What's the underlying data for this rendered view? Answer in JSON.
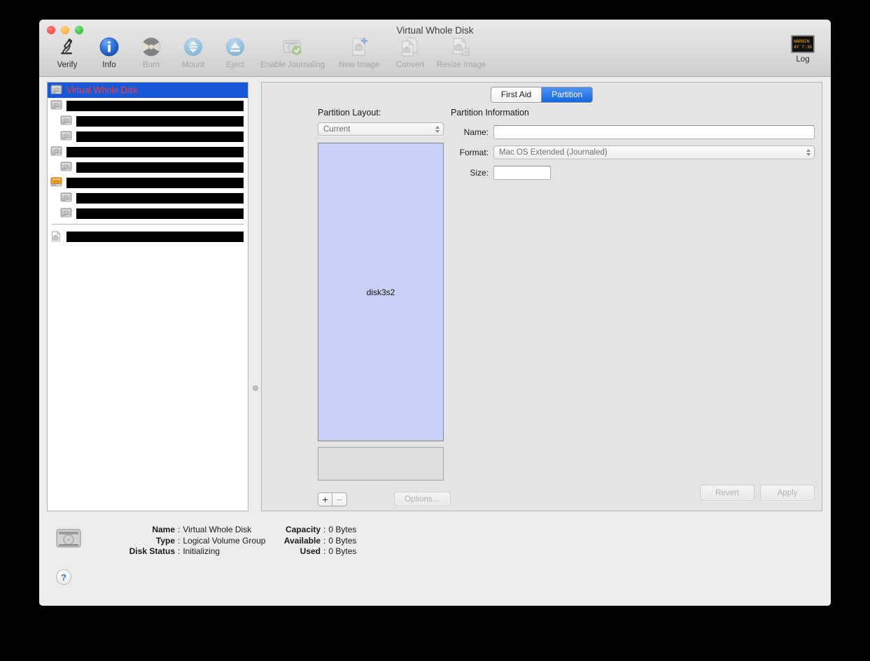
{
  "window": {
    "title": "Virtual Whole Disk"
  },
  "toolbar": {
    "items": [
      {
        "label": "Verify",
        "icon": "microscope-icon",
        "enabled": true
      },
      {
        "label": "Info",
        "icon": "info-circle-icon",
        "enabled": true
      },
      {
        "label": "Burn",
        "icon": "burn-radioactive-icon",
        "enabled": false
      },
      {
        "label": "Mount",
        "icon": "mount-arrows-icon",
        "enabled": false
      },
      {
        "label": "Eject",
        "icon": "eject-icon",
        "enabled": false
      },
      {
        "label": "Enable Journaling",
        "icon": "journaling-disk-check-icon",
        "enabled": false
      },
      {
        "label": "New Image",
        "icon": "new-image-icon",
        "enabled": false
      },
      {
        "label": "Convert",
        "icon": "convert-image-icon",
        "enabled": false
      },
      {
        "label": "Resize Image",
        "icon": "resize-image-icon",
        "enabled": false
      }
    ],
    "log": {
      "label": "Log",
      "screen_lines": [
        "WARNIN",
        "AY 7:36"
      ],
      "text_color": "#e8a317"
    }
  },
  "sidebar": {
    "rows": [
      {
        "icon": "hard-disk-icon",
        "label": "Virtual Whole Disk",
        "selected": true,
        "redacted": false,
        "indent": false
      },
      {
        "icon": "hard-disk-icon",
        "label": "",
        "selected": false,
        "redacted": true,
        "indent": false
      },
      {
        "icon": "volume-icon",
        "label": "",
        "selected": false,
        "redacted": true,
        "indent": true
      },
      {
        "icon": "volume-icon",
        "label": "",
        "selected": false,
        "redacted": true,
        "indent": true
      },
      {
        "icon": "hard-disk-icon",
        "label": "",
        "selected": false,
        "redacted": true,
        "indent": false
      },
      {
        "icon": "volume-icon",
        "label": "",
        "selected": false,
        "redacted": true,
        "indent": true
      },
      {
        "icon": "hard-disk-orange-icon",
        "label": "",
        "selected": false,
        "redacted": true,
        "indent": false
      },
      {
        "icon": "volume-icon",
        "label": "",
        "selected": false,
        "redacted": true,
        "indent": true
      },
      {
        "icon": "volume-icon",
        "label": "",
        "selected": false,
        "redacted": true,
        "indent": true
      }
    ],
    "after_divider": [
      {
        "icon": "disk-image-icon",
        "label": "",
        "selected": false,
        "redacted": true,
        "indent": false
      }
    ]
  },
  "tabs": [
    {
      "label": "First Aid",
      "active": false
    },
    {
      "label": "Partition",
      "active": true
    }
  ],
  "partition_layout": {
    "section_label": "Partition Layout:",
    "scheme_value": "Current",
    "partitions": [
      {
        "name": "disk3s2"
      }
    ],
    "add_button": "+",
    "remove_button": "−",
    "options_button": "Options…",
    "options_enabled": false
  },
  "partition_information": {
    "section_label": "Partition Information",
    "name_label": "Name:",
    "name_value": "",
    "format_label": "Format:",
    "format_value": "Mac OS Extended (Journaled)",
    "size_label": "Size:",
    "size_value": "",
    "revert_button": "Revert",
    "apply_button": "Apply",
    "buttons_enabled": false
  },
  "info_bar": {
    "help_button": "?",
    "disk_icon": "hard-disk-icon",
    "left": [
      {
        "key": "Name",
        "sep": ":",
        "value": "Virtual Whole Disk"
      },
      {
        "key": "Type",
        "sep": ":",
        "value": "Logical Volume Group"
      },
      {
        "key": "Disk Status",
        "sep": ":",
        "value": "Initializing"
      }
    ],
    "right": [
      {
        "key": "Capacity",
        "sep": ":",
        "value": "0 Bytes"
      },
      {
        "key": "Available",
        "sep": ":",
        "value": "0 Bytes"
      },
      {
        "key": "Used",
        "sep": ":",
        "value": "0 Bytes"
      }
    ]
  },
  "colors": {
    "selection_blue": "#1758d8",
    "selected_label_red": "#f2403a",
    "partition_fill": "#c7d0f7",
    "tab_active": "#1267e0"
  }
}
